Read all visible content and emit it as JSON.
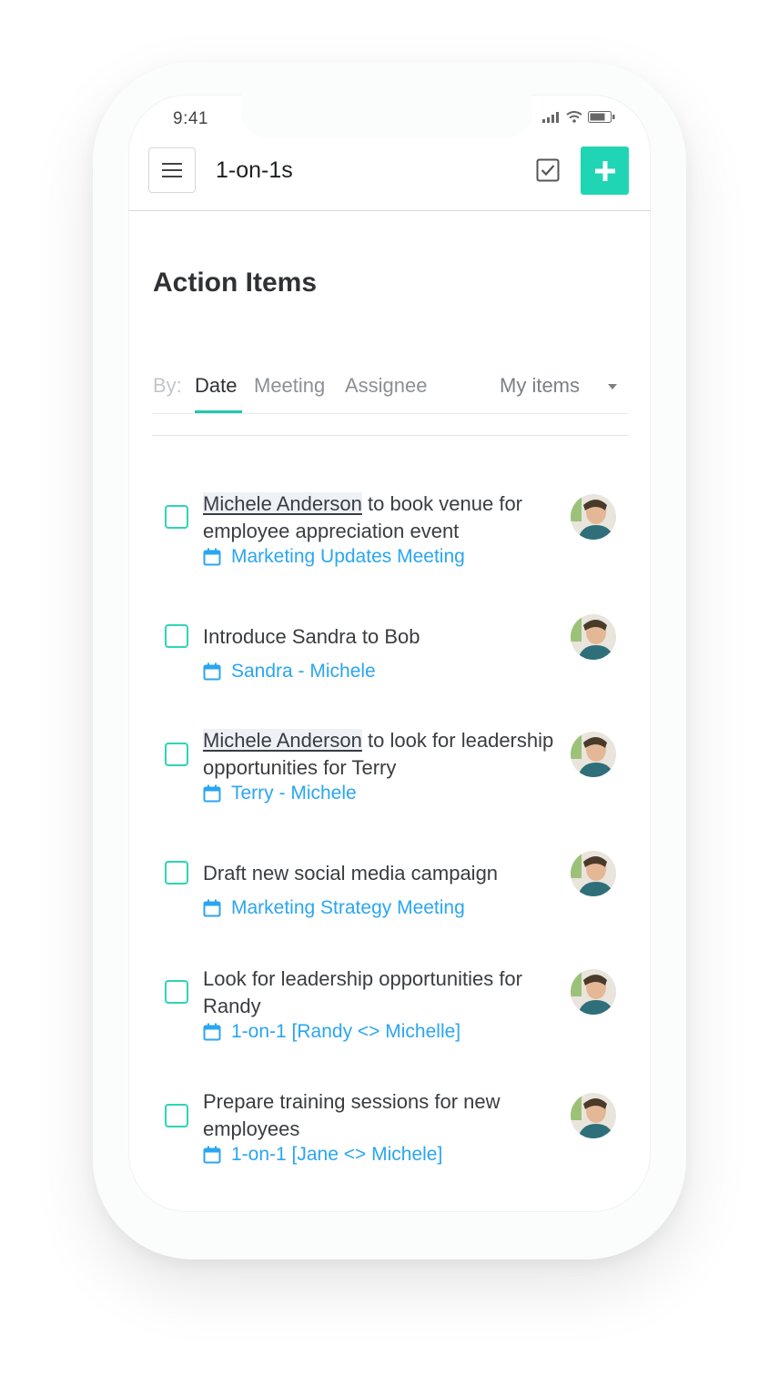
{
  "status": {
    "time": "9:41"
  },
  "header": {
    "title": "1-on-1s"
  },
  "page": {
    "title": "Action Items"
  },
  "filters": {
    "by_label": "By:",
    "tabs": [
      "Date",
      "Meeting",
      "Assignee"
    ],
    "active_tab": "Date",
    "scope": "My items"
  },
  "items": [
    {
      "assignee": "Michele Anderson",
      "text": " to book venue for employee appreciation event",
      "meeting": "Marketing Updates Meeting"
    },
    {
      "assignee": "",
      "text": "Introduce Sandra to Bob",
      "meeting": "Sandra - Michele"
    },
    {
      "assignee": "Michele Anderson",
      "text": " to look for leadership opportunities for Terry",
      "meeting": "Terry - Michele"
    },
    {
      "assignee": "",
      "text": "Draft new social media campaign",
      "meeting": "Marketing Strategy Meeting"
    },
    {
      "assignee": "",
      "text": "Look for leadership opportunities for Randy",
      "meeting": "1-on-1 [Randy <> Michelle]"
    },
    {
      "assignee": "",
      "text": "Prepare training sessions for new employees",
      "meeting": "1-on-1 [Jane <> Michele]"
    }
  ],
  "colors": {
    "accent": "#20d5b4",
    "link": "#2aa6ef",
    "checkbox": "#2fd4b5"
  },
  "icons": {
    "menu": "menu-icon",
    "check": "checkbox-icon",
    "add": "plus-icon",
    "calendar": "calendar-icon"
  }
}
